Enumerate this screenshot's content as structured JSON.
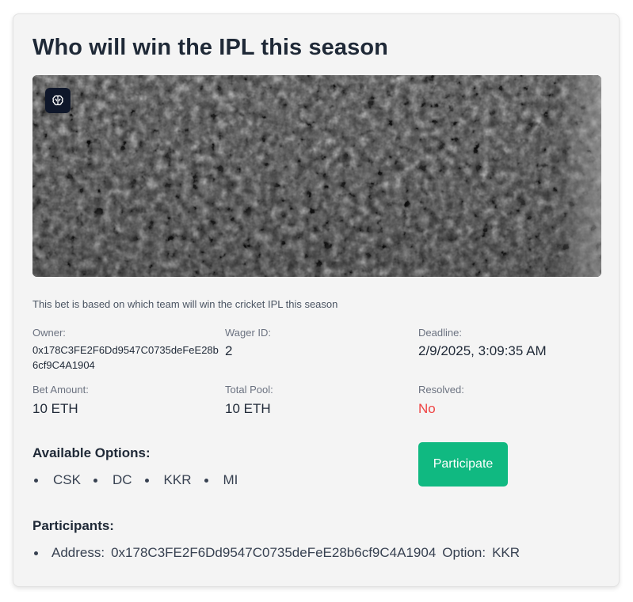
{
  "bet": {
    "title": "Who will win the IPL this season",
    "description": "This bet is based on which team will win the cricket IPL this season",
    "image_icon": "brain-icon"
  },
  "details": {
    "owner_label": "Owner:",
    "owner_value": "0x178C3FE2F6Dd9547C0735deFeE28b6cf9C4A1904",
    "wager_id_label": "Wager ID:",
    "wager_id_value": "2",
    "deadline_label": "Deadline:",
    "deadline_value": "2/9/2025, 3:09:35 AM",
    "bet_amount_label": "Bet Amount:",
    "bet_amount_value": "10 ETH",
    "total_pool_label": "Total Pool:",
    "total_pool_value": "10 ETH",
    "resolved_label": "Resolved:",
    "resolved_value": "No"
  },
  "options": {
    "heading": "Available Options:",
    "items": [
      "CSK",
      "DC",
      "KKR",
      "MI"
    ]
  },
  "actions": {
    "participate_label": "Participate"
  },
  "participants": {
    "heading": "Participants:",
    "items": [
      {
        "address_label": "Address:",
        "address": "0x178C3FE2F6Dd9547C0735deFeE28b6cf9C4A1904",
        "option_label": "Option:",
        "option": "KKR"
      }
    ]
  },
  "colors": {
    "card_bg": "#f4f4f4",
    "title": "#1f2937",
    "button": "#10b981",
    "resolved_no": "#ef4444",
    "badge": "#0f172a"
  }
}
